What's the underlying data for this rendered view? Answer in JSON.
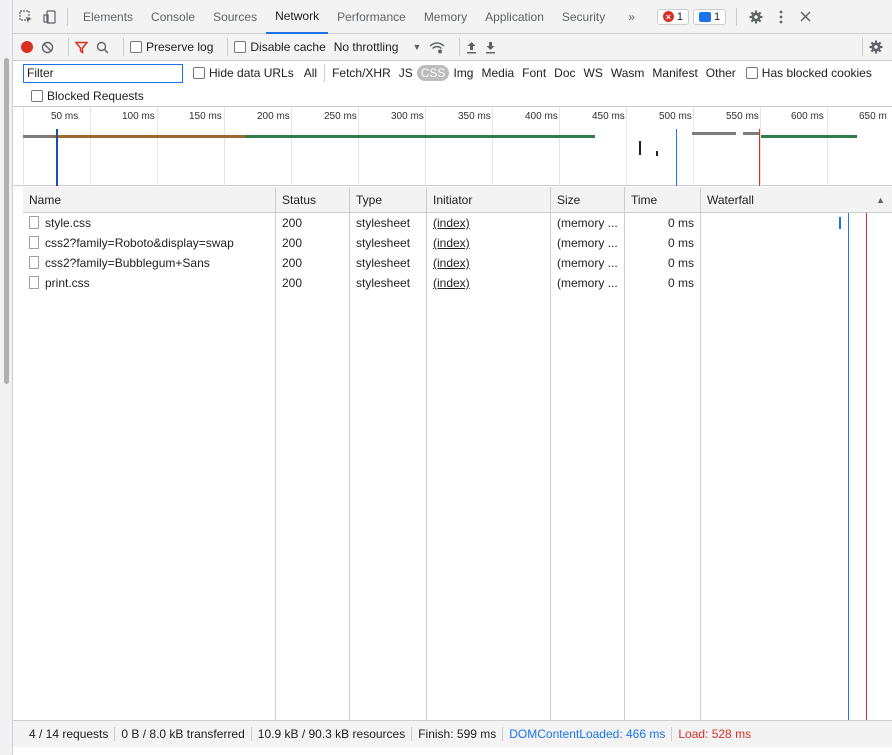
{
  "tabs": {
    "items": [
      "Elements",
      "Console",
      "Sources",
      "Network",
      "Performance",
      "Memory",
      "Application",
      "Security"
    ],
    "more": "»",
    "errors_count": "1",
    "messages_count": "1"
  },
  "toolbar": {
    "preserve_log": "Preserve log",
    "disable_cache": "Disable cache",
    "throttling": "No throttling"
  },
  "filter": {
    "placeholder": "Filter",
    "hide_data_urls": "Hide data URLs",
    "types": [
      "All",
      "Fetch/XHR",
      "JS",
      "CSS",
      "Img",
      "Media",
      "Font",
      "Doc",
      "WS",
      "Wasm",
      "Manifest",
      "Other"
    ],
    "selected_type": "CSS",
    "has_blocked_cookies": "Has blocked cookies",
    "blocked_requests": "Blocked Requests"
  },
  "overview": {
    "ticks": [
      "50 ms",
      "100 ms",
      "150 ms",
      "200 ms",
      "250 ms",
      "300 ms",
      "350 ms",
      "400 ms",
      "450 ms",
      "500 ms",
      "550 ms",
      "600 ms",
      "650 m"
    ]
  },
  "table": {
    "headers": {
      "name": "Name",
      "status": "Status",
      "type": "Type",
      "initiator": "Initiator",
      "size": "Size",
      "time": "Time",
      "waterfall": "Waterfall"
    },
    "rows": [
      {
        "name": "style.css",
        "status": "200",
        "type": "stylesheet",
        "initiator": "(index)",
        "size": "(memory ...",
        "time": "0 ms"
      },
      {
        "name": "css2?family=Roboto&display=swap",
        "status": "200",
        "type": "stylesheet",
        "initiator": "(index)",
        "size": "(memory ...",
        "time": "0 ms"
      },
      {
        "name": "css2?family=Bubblegum+Sans",
        "status": "200",
        "type": "stylesheet",
        "initiator": "(index)",
        "size": "(memory ...",
        "time": "0 ms"
      },
      {
        "name": "print.css",
        "status": "200",
        "type": "stylesheet",
        "initiator": "(index)",
        "size": "(memory ...",
        "time": "0 ms"
      }
    ]
  },
  "status": {
    "requests": "4 / 14 requests",
    "transferred": "0 B / 8.0 kB transferred",
    "resources": "10.9 kB / 90.3 kB resources",
    "finish": "Finish: 599 ms",
    "dom_content_loaded": "DOMContentLoaded: 466 ms",
    "load": "Load: 528 ms"
  },
  "colors": {
    "accent": "#1a73e8",
    "error": "#d93025",
    "dcl": "#1a73e8",
    "load": "#d93025"
  }
}
